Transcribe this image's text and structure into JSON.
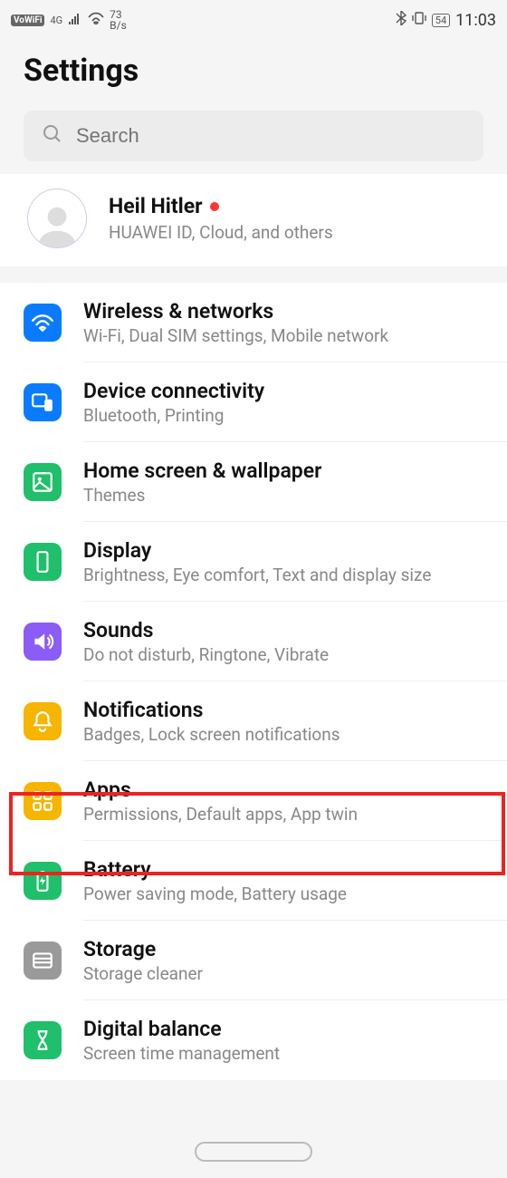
{
  "status": {
    "vowifi": "VoWiFi",
    "net": "4G",
    "speed_top": "73",
    "speed_bot": "B/s",
    "battery": "54",
    "time": "11:03"
  },
  "title": "Settings",
  "search": {
    "placeholder": "Search"
  },
  "profile": {
    "name": "Heil Hitler",
    "sub": "HUAWEI ID, Cloud, and others"
  },
  "items": [
    {
      "title": "Wireless & networks",
      "sub": "Wi-Fi, Dual SIM settings, Mobile network",
      "icon": "wifi",
      "color": "c-blue"
    },
    {
      "title": "Device connectivity",
      "sub": "Bluetooth, Printing",
      "icon": "devices",
      "color": "c-blue2"
    },
    {
      "title": "Home screen & wallpaper",
      "sub": "Themes",
      "icon": "image",
      "color": "c-green"
    },
    {
      "title": "Display",
      "sub": "Brightness, Eye comfort, Text and display size",
      "icon": "phone",
      "color": "c-green"
    },
    {
      "title": "Sounds",
      "sub": "Do not disturb, Ringtone, Vibrate",
      "icon": "sound",
      "color": "c-purple"
    },
    {
      "title": "Notifications",
      "sub": "Badges, Lock screen notifications",
      "icon": "bell",
      "color": "c-amber"
    },
    {
      "title": "Apps",
      "sub": "Permissions, Default apps, App twin",
      "icon": "apps",
      "color": "c-amber"
    },
    {
      "title": "Battery",
      "sub": "Power saving mode, Battery usage",
      "icon": "battery",
      "color": "c-green"
    },
    {
      "title": "Storage",
      "sub": "Storage cleaner",
      "icon": "storage",
      "color": "c-gray"
    },
    {
      "title": "Digital balance",
      "sub": "Screen time management",
      "icon": "hourglass",
      "color": "c-green"
    }
  ]
}
